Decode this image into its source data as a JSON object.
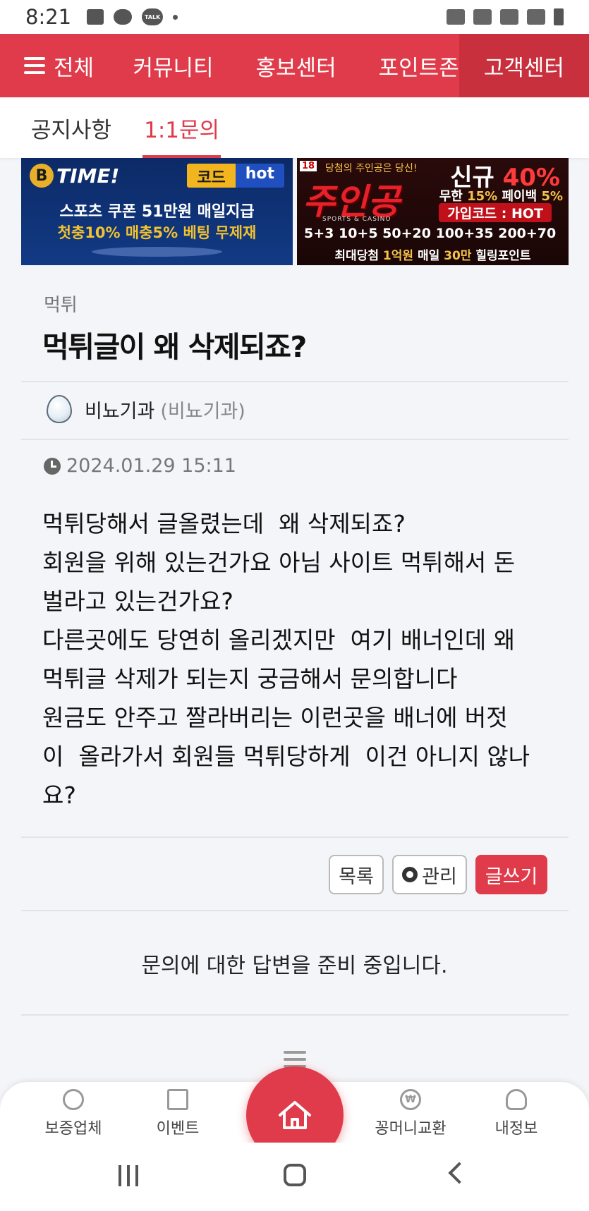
{
  "status_bar": {
    "time": "8:21",
    "talk_label": "TALK"
  },
  "top_nav": {
    "all_label": "전체",
    "items": [
      "커뮤니티",
      "홍보센터",
      "포인트존",
      "고객센터"
    ],
    "active": "고객센터"
  },
  "sub_tabs": {
    "items": [
      "공지사항",
      "1:1문의"
    ],
    "active": "1:1문의"
  },
  "banners": {
    "left": {
      "brand": "TIME!",
      "brand_letter": "B",
      "code_label": "코드",
      "code_value": "hot",
      "line1": "스포츠 쿠폰 51만원 매일지급",
      "line2": "첫충10% 매충5% 베팅 무제재"
    },
    "right": {
      "age_tag": "18",
      "top_text": "당첨의 주인공은 당신!",
      "brand": "주인공",
      "brand_sub": "SPORTS & CASINO",
      "new_label": "신규",
      "new_pct": "40%",
      "payback_a": "무한",
      "payback_b": "15%",
      "payback_c": "페이백",
      "payback_d": "5%",
      "join_code": "가입코드 : HOT",
      "bonus": "5+3 10+5 50+20 100+35 200+70",
      "foot_a": "최대당첨",
      "foot_b": "1억원",
      "foot_c": "매일",
      "foot_d": "30만",
      "foot_e": "힐링포인트"
    }
  },
  "post": {
    "category": "먹튀",
    "title": "먹튀글이 왜 삭제되죠?",
    "author_name": "비뇨기과",
    "author_id": "(비뇨기과)",
    "date": "2024.01.29 15:11",
    "body_lines": [
      "먹튀당해서 글올렸는데  왜 삭제되죠?",
      "회원을 위해 있는건가요 아님 사이트 먹튀해서 돈",
      "벌라고 있는건가요?",
      "다른곳에도 당연히 올리겠지만  여기 배너인데 왜",
      "먹튀글 삭제가 되는지 궁금해서 문의합니다",
      "원금도 안주고 짤라버리는 이런곳을 배너에 버젓",
      "이  올라가서 회원들 먹튀당하게  이건 아니지 않나",
      "요?"
    ]
  },
  "actions": {
    "list": "목록",
    "admin": "관리",
    "write": "글쓰기"
  },
  "answer_message": "문의에 대한 답변을 준비 중입니다.",
  "bottom_nav": {
    "items": [
      "보증업체",
      "이벤트",
      "꽁머니교환",
      "내정보"
    ],
    "won_symbol": "₩"
  },
  "colors": {
    "accent": "#e03b4a",
    "accent_dark": "#c9303e"
  }
}
